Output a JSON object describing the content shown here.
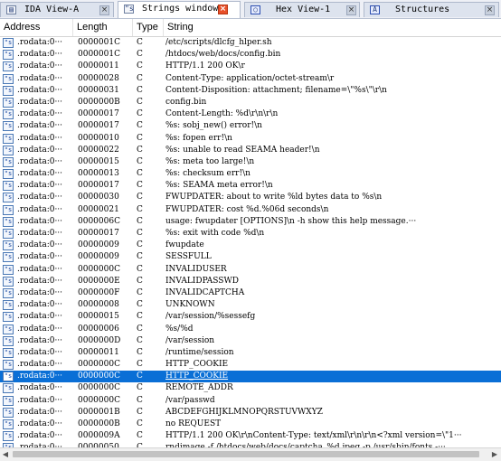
{
  "tabs": [
    {
      "label": "IDA View-A",
      "icon": "ida-view-icon",
      "active": false
    },
    {
      "label": "Strings window",
      "icon": "strings-icon",
      "active": true
    },
    {
      "label": "Hex View-1",
      "icon": "hex-view-icon",
      "active": false
    },
    {
      "label": "Structures",
      "icon": "structures-icon",
      "active": false
    }
  ],
  "close_glyph": "×",
  "columns": [
    "Address",
    "Length",
    "Type",
    "String"
  ],
  "selected_index": 28,
  "colors": {
    "selection": "#0a6fd6",
    "active_close": "#e8502a"
  },
  "rows": [
    {
      "address": ".rodata:0···",
      "length": "0000001C",
      "type": "C",
      "string": "/etc/scripts/dlcfg_hlper.sh"
    },
    {
      "address": ".rodata:0···",
      "length": "0000001C",
      "type": "C",
      "string": "/htdocs/web/docs/config.bin"
    },
    {
      "address": ".rodata:0···",
      "length": "00000011",
      "type": "C",
      "string": "HTTP/1.1 200 OK\\r"
    },
    {
      "address": ".rodata:0···",
      "length": "00000028",
      "type": "C",
      "string": "Content-Type: application/octet-stream\\r"
    },
    {
      "address": ".rodata:0···",
      "length": "00000031",
      "type": "C",
      "string": "Content-Disposition: attachment; filename=\\\"%s\\\"\\r\\n"
    },
    {
      "address": ".rodata:0···",
      "length": "0000000B",
      "type": "C",
      "string": "config.bin"
    },
    {
      "address": ".rodata:0···",
      "length": "00000017",
      "type": "C",
      "string": "Content-Length: %d\\r\\n\\r\\n"
    },
    {
      "address": ".rodata:0···",
      "length": "00000017",
      "type": "C",
      "string": "%s: sobj_new() error!\\n"
    },
    {
      "address": ".rodata:0···",
      "length": "00000010",
      "type": "C",
      "string": "%s: fopen err!\\n"
    },
    {
      "address": ".rodata:0···",
      "length": "00000022",
      "type": "C",
      "string": "%s: unable to read SEAMA header!\\n"
    },
    {
      "address": ".rodata:0···",
      "length": "00000015",
      "type": "C",
      "string": "%s: meta too large!\\n"
    },
    {
      "address": ".rodata:0···",
      "length": "00000013",
      "type": "C",
      "string": "%s: checksum err!\\n"
    },
    {
      "address": ".rodata:0···",
      "length": "00000017",
      "type": "C",
      "string": "%s: SEAMA meta error!\\n"
    },
    {
      "address": ".rodata:0···",
      "length": "00000030",
      "type": "C",
      "string": "FWUPDATER: about to write %ld bytes data to %s\\n"
    },
    {
      "address": ".rodata:0···",
      "length": "00000021",
      "type": "C",
      "string": "FWUPDATER: cost %d.%06d seconds\\n"
    },
    {
      "address": ".rodata:0···",
      "length": "0000006C",
      "type": "C",
      "string": "usage: fwupdater [OPTIONS]\\n  -h           show this help message.···"
    },
    {
      "address": ".rodata:0···",
      "length": "00000017",
      "type": "C",
      "string": "%s: exit with code %d\\n"
    },
    {
      "address": ".rodata:0···",
      "length": "00000009",
      "type": "C",
      "string": "fwupdate"
    },
    {
      "address": ".rodata:0···",
      "length": "00000009",
      "type": "C",
      "string": "SESSFULL"
    },
    {
      "address": ".rodata:0···",
      "length": "0000000C",
      "type": "C",
      "string": "INVALIDUSER"
    },
    {
      "address": ".rodata:0···",
      "length": "0000000E",
      "type": "C",
      "string": "INVALIDPASSWD"
    },
    {
      "address": ".rodata:0···",
      "length": "0000000F",
      "type": "C",
      "string": "INVALIDCAPTCHA"
    },
    {
      "address": ".rodata:0···",
      "length": "00000008",
      "type": "C",
      "string": "UNKNOWN"
    },
    {
      "address": ".rodata:0···",
      "length": "00000015",
      "type": "C",
      "string": "/var/session/%sessefg"
    },
    {
      "address": ".rodata:0···",
      "length": "00000006",
      "type": "C",
      "string": "%s/%d"
    },
    {
      "address": ".rodata:0···",
      "length": "0000000D",
      "type": "C",
      "string": "/var/session"
    },
    {
      "address": ".rodata:0···",
      "length": "00000011",
      "type": "C",
      "string": "/runtime/session"
    },
    {
      "address": ".rodata:0···",
      "length": "0000000C",
      "type": "C",
      "string": "HTTP_COOKIE"
    },
    {
      "address": ".rodata:0···",
      "length": "0000000C",
      "type": "C",
      "string": "HTTP_COOKIE"
    },
    {
      "address": ".rodata:0···",
      "length": "0000000C",
      "type": "C",
      "string": "REMOTE_ADDR"
    },
    {
      "address": ".rodata:0···",
      "length": "0000000C",
      "type": "C",
      "string": "/var/passwd"
    },
    {
      "address": ".rodata:0···",
      "length": "0000001B",
      "type": "C",
      "string": "ABCDEFGHIJKLMNOPQRSTUVWXYZ"
    },
    {
      "address": ".rodata:0···",
      "length": "0000000B",
      "type": "C",
      "string": "no REQUEST"
    },
    {
      "address": ".rodata:0···",
      "length": "0000009A",
      "type": "C",
      "string": "HTTP/1.1 200 OK\\r\\nContent-Type: text/xml\\r\\n\\r\\n<?xml version=\\\"1···"
    },
    {
      "address": ".rodata:0···",
      "length": "00000050",
      "type": "C",
      "string": "rndimage -f /htdocs/web/docs/captcha_%d.jpeg -p /usr/sbin/fonts -···"
    }
  ]
}
